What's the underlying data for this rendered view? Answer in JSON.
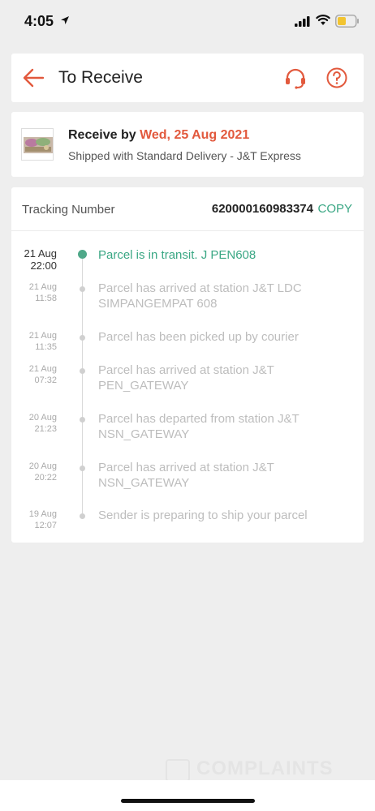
{
  "status_bar": {
    "time": "4:05"
  },
  "header": {
    "title": "To Receive",
    "back_icon": "arrow-left-icon",
    "support_icon": "headset-icon",
    "help_icon": "question-circle-icon",
    "accent_color": "#e2593d"
  },
  "receive": {
    "prefix": "Receive by ",
    "date": "Wed, 25 Aug 2021",
    "shipping": "Shipped with Standard Delivery  - J&T Express"
  },
  "tracking": {
    "label": "Tracking Number",
    "number": "620000160983374",
    "copy_label": "COPY",
    "active_color": "#3aa784",
    "events": [
      {
        "date": "21 Aug",
        "time": "22:00",
        "lines": [
          "Parcel is in transit. J PEN608"
        ],
        "active": true
      },
      {
        "date": "21 Aug",
        "time": "11:58",
        "lines": [
          "Parcel has arrived at station J&T LDC",
          "SIMPANGEMPAT 608"
        ],
        "active": false
      },
      {
        "date": "21 Aug",
        "time": "11:35",
        "lines": [
          "Parcel has been picked up by courier"
        ],
        "active": false
      },
      {
        "date": "21 Aug",
        "time": "07:32",
        "lines": [
          "Parcel has arrived at station J&T",
          "PEN_GATEWAY"
        ],
        "active": false
      },
      {
        "date": "20 Aug",
        "time": "21:23",
        "lines": [
          "Parcel has departed from station J&T",
          "NSN_GATEWAY"
        ],
        "active": false
      },
      {
        "date": "20 Aug",
        "time": "20:22",
        "lines": [
          "Parcel has arrived at station J&T",
          "NSN_GATEWAY"
        ],
        "active": false
      },
      {
        "date": "19 Aug",
        "time": "12:07",
        "lines": [
          "Sender is preparing to ship your parcel"
        ],
        "active": false
      }
    ]
  },
  "watermark": {
    "text": "COMPLAINTS"
  }
}
